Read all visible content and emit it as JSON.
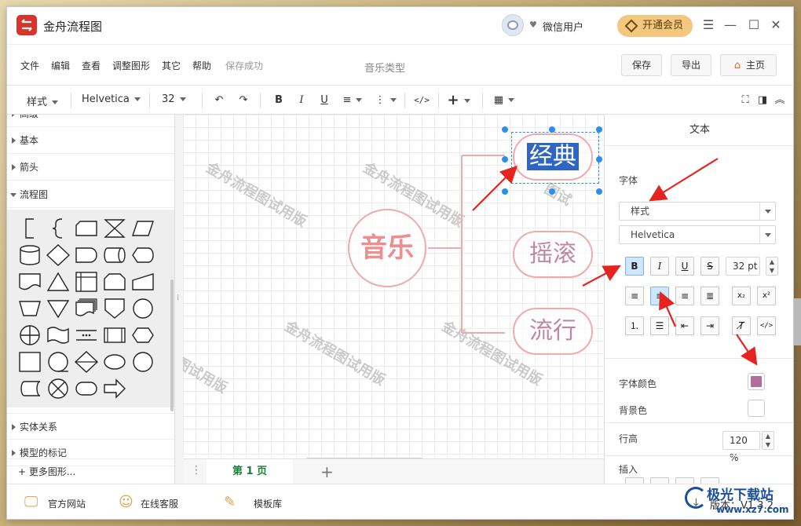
{
  "app": {
    "title": "金舟流程图",
    "user_name": "微信用户",
    "vip_label": "开通会员"
  },
  "menu": {
    "items": [
      "文件",
      "编辑",
      "查看",
      "调整图形",
      "其它",
      "帮助"
    ],
    "status": "保存成功",
    "doc_title": "音乐类型",
    "save_label": "保存",
    "export_label": "导出",
    "home_label": "主页"
  },
  "toolbar": {
    "style_label": "样式",
    "font_label": "Helvetica",
    "size_label": "32"
  },
  "sidebar": {
    "categories": [
      "高级",
      "基本",
      "箭头",
      "流程图",
      "实体关系",
      "模型的标记"
    ],
    "more_shapes": "+ 更多图形..."
  },
  "canvas": {
    "watermark": "金舟流程图试用版",
    "watermark_partial_1": "图试用版",
    "watermark_partial_2": "图试",
    "center_node": "音乐",
    "branches": [
      "经典",
      "摇滚",
      "流行"
    ]
  },
  "pages": {
    "tab_label": "第 1 页"
  },
  "right_panel": {
    "header": "文本",
    "font_label": "字体",
    "style_select": "样式",
    "font_select": "Helvetica",
    "bold": "B",
    "italic": "I",
    "underline": "U",
    "strike": "S",
    "font_size": "32 pt",
    "font_color_label": "字体颜色",
    "font_color": "#b26d9c",
    "bg_color_label": "背景色",
    "bg_color": "#ffffff",
    "line_height_label": "行高",
    "line_height": "120 %",
    "insert_label": "插入"
  },
  "statusbar": {
    "official_site": "官方网站",
    "online_service": "在线客服",
    "templates": "模板库",
    "version": "版本：V1.3.2"
  },
  "brand": {
    "name": "极光下载站",
    "url": "www.xz7.com"
  },
  "colors": {
    "accent_red": "#d9342b",
    "node_border": "#f2a9a9",
    "selection_blue": "#2b8ff0",
    "arrow_red": "#e52420"
  }
}
